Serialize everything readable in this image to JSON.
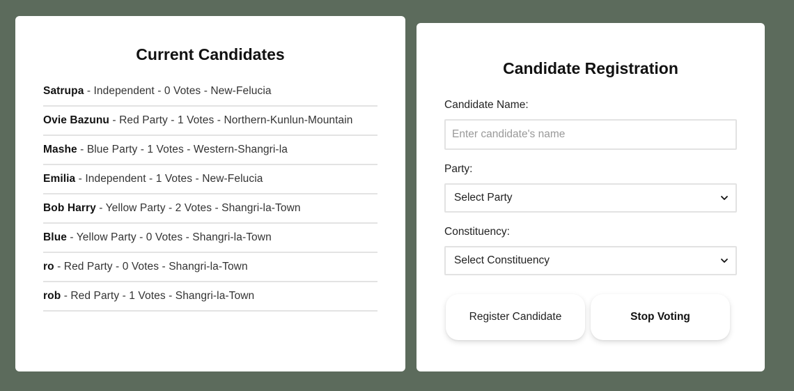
{
  "candidates_panel": {
    "title": "Current Candidates",
    "separator": " - ",
    "candidates": [
      {
        "name": "Satrupa",
        "party": "Independent",
        "votes": "0 Votes",
        "constituency": "New-Felucia"
      },
      {
        "name": "Ovie Bazunu",
        "party": "Red Party",
        "votes": "1 Votes",
        "constituency": "Northern-Kunlun-Mountain"
      },
      {
        "name": "Mashe",
        "party": "Blue Party",
        "votes": "1 Votes",
        "constituency": "Western-Shangri-la"
      },
      {
        "name": "Emilia",
        "party": "Independent",
        "votes": "1 Votes",
        "constituency": "New-Felucia"
      },
      {
        "name": "Bob Harry",
        "party": "Yellow Party",
        "votes": "2 Votes",
        "constituency": "Shangri-la-Town"
      },
      {
        "name": "Blue",
        "party": "Yellow Party",
        "votes": "0 Votes",
        "constituency": "Shangri-la-Town"
      },
      {
        "name": "ro",
        "party": "Red Party",
        "votes": "0 Votes",
        "constituency": "Shangri-la-Town"
      },
      {
        "name": "rob",
        "party": "Red Party",
        "votes": "1 Votes",
        "constituency": "Shangri-la-Town"
      }
    ]
  },
  "registration_panel": {
    "title": "Candidate Registration",
    "name_label": "Candidate Name:",
    "name_placeholder": "Enter candidate's name",
    "name_value": "",
    "party_label": "Party:",
    "party_selected": "Select Party",
    "constituency_label": "Constituency:",
    "constituency_selected": "Select Constituency",
    "register_button_label": "Register Candidate",
    "stop_voting_button_label": "Stop Voting"
  },
  "colors": {
    "background": "#5c6b5c",
    "panel": "#ffffff",
    "divider": "#e3e3e3"
  }
}
